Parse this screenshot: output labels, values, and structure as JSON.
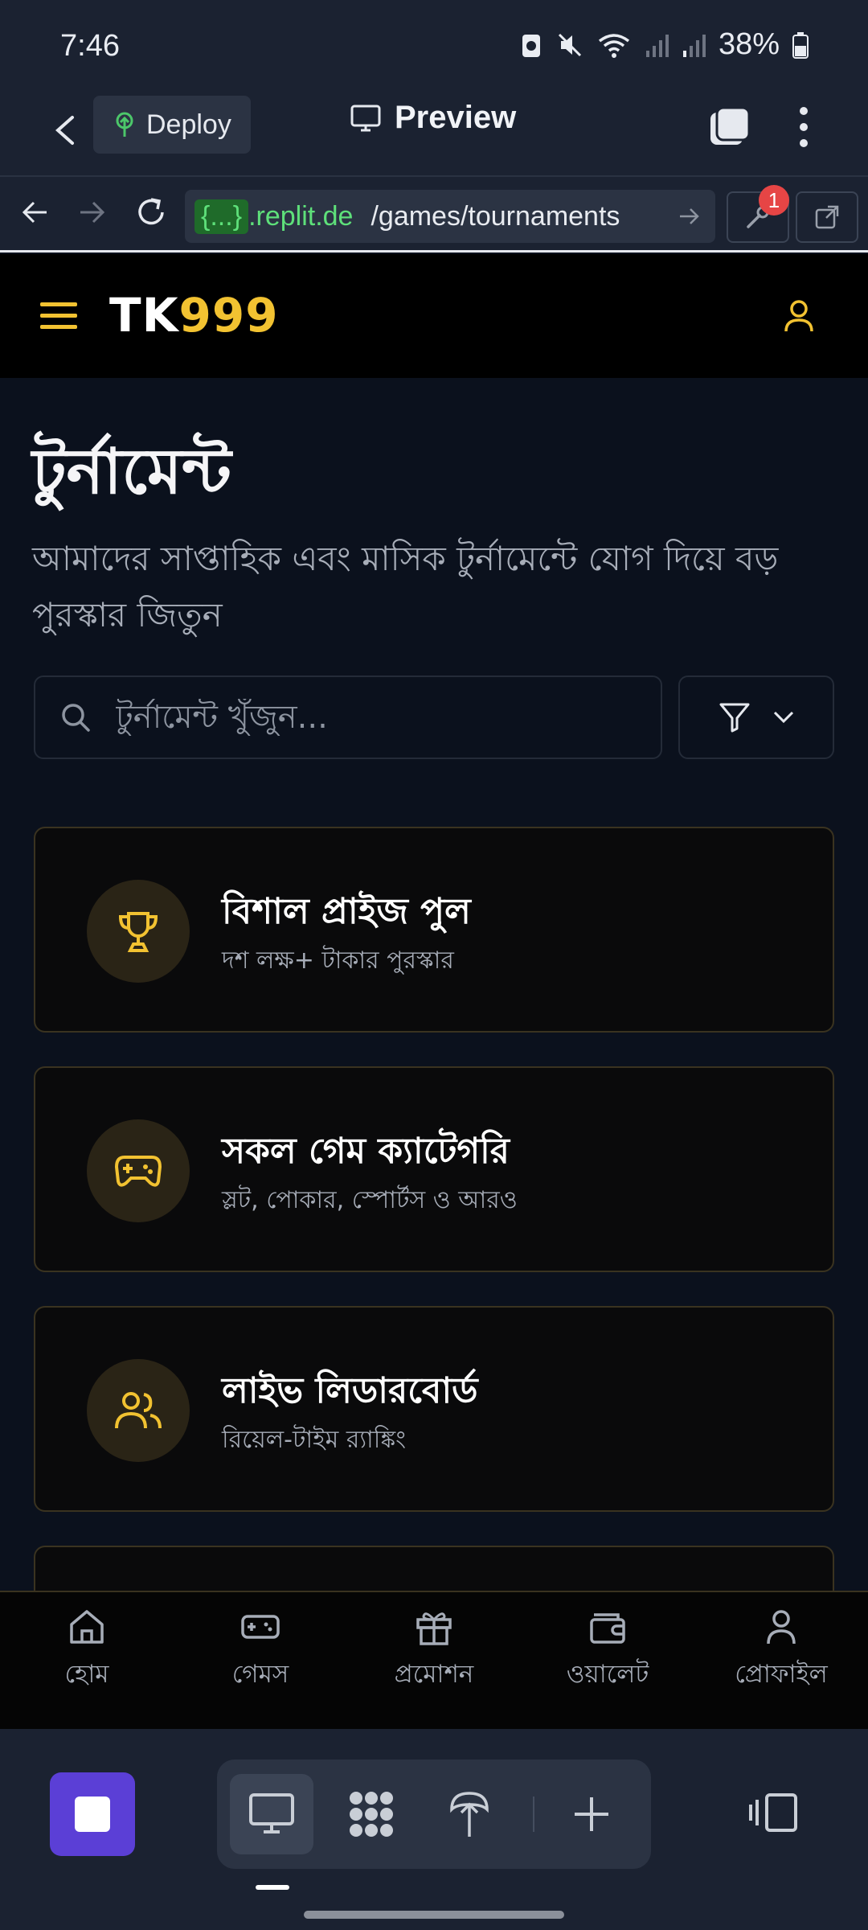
{
  "status_bar": {
    "time": "7:46",
    "battery": "38%"
  },
  "replit_header": {
    "deploy_label": "Deploy",
    "preview_label": "Preview"
  },
  "url_bar": {
    "brace": "{...}",
    "host": ".replit.de",
    "path": "/games/tournaments",
    "notification_count": "1"
  },
  "site": {
    "logo_part1": "TK",
    "logo_part2": "999"
  },
  "page": {
    "title": "টুর্নামেন্ট",
    "subtitle": "আমাদের সাপ্তাহিক এবং মাসিক টুর্নামেন্টে যোগ দিয়ে বড় পুরস্কার জিতুন",
    "search_placeholder": "টুর্নামেন্ট খুঁজুন..."
  },
  "features": [
    {
      "title": "বিশাল প্রাইজ পুল",
      "desc": "দশ লক্ষ+ টাকার পুরস্কার",
      "icon": "trophy-icon"
    },
    {
      "title": "সকল গেম ক্যাটেগরি",
      "desc": "স্লট, পোকার, স্পোর্টস ও আরও",
      "icon": "gamepad-icon"
    },
    {
      "title": "লাইভ লিডারবোর্ড",
      "desc": "রিয়েল-টাইম র‍্যাঙ্কিং",
      "icon": "users-icon"
    }
  ],
  "bottom_nav": [
    {
      "label": "হোম",
      "icon": "home-icon"
    },
    {
      "label": "গেমস",
      "icon": "gamepad-icon"
    },
    {
      "label": "প্রমোশন",
      "icon": "gift-icon"
    },
    {
      "label": "ওয়ালেট",
      "icon": "wallet-icon"
    },
    {
      "label": "প্রোফাইল",
      "icon": "user-icon"
    }
  ],
  "colors": {
    "accent": "#f2c231",
    "background": "#0b111d",
    "card": "#0a0a0b",
    "replit_chrome": "#1b2231",
    "replit_purple": "#5b3fd6"
  }
}
